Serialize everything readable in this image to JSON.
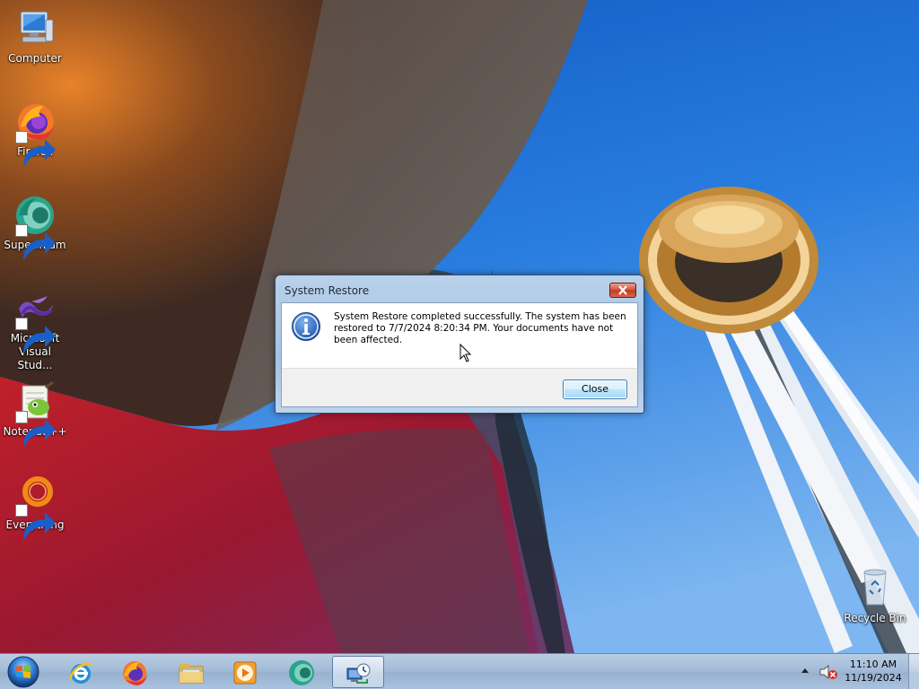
{
  "desktop": {
    "icons": [
      {
        "label": "Computer",
        "icon": "computer-icon",
        "shortcut": false
      },
      {
        "label": "Firefox",
        "icon": "firefox-icon",
        "shortcut": true
      },
      {
        "label": "Supermium",
        "icon": "supermium-icon",
        "shortcut": true
      },
      {
        "label": "Microsoft Visual Stud...",
        "icon": "visual-studio-icon",
        "shortcut": true
      },
      {
        "label": "Notepad++",
        "icon": "notepad-plus-plus-icon",
        "shortcut": true
      },
      {
        "label": "Everything",
        "icon": "everything-search-icon",
        "shortcut": true
      },
      {
        "label": "Recycle Bin",
        "icon": "recycle-bin-icon",
        "shortcut": false
      }
    ]
  },
  "dialog": {
    "title": "System Restore",
    "icon": "information-icon",
    "message": "System Restore completed successfully. The system has been restored to 7/7/2024 8:20:34 PM. Your documents have not been affected.",
    "close_button_label": "Close"
  },
  "taskbar": {
    "start": "windows-start-orb",
    "pinned": [
      {
        "app": "Internet Explorer",
        "icon": "internet-explorer-icon",
        "active": false
      },
      {
        "app": "Firefox",
        "icon": "firefox-icon",
        "active": false
      },
      {
        "app": "File Explorer",
        "icon": "folder-icon",
        "active": false
      },
      {
        "app": "Windows Media Player",
        "icon": "media-player-icon",
        "active": false
      },
      {
        "app": "Supermium",
        "icon": "supermium-icon",
        "active": false
      },
      {
        "app": "System Restore",
        "icon": "system-restore-icon",
        "active": true
      }
    ],
    "tray": {
      "volume_state": "muted",
      "time": "11:10 AM",
      "date": "11/19/2024"
    }
  },
  "colors": {
    "sky": "#1f73d6",
    "tower_gold": "#c08a3a",
    "taskbar": "#a4bcd8",
    "dialog_frame": "#b9d1ea",
    "close_red": "#c8452e"
  }
}
